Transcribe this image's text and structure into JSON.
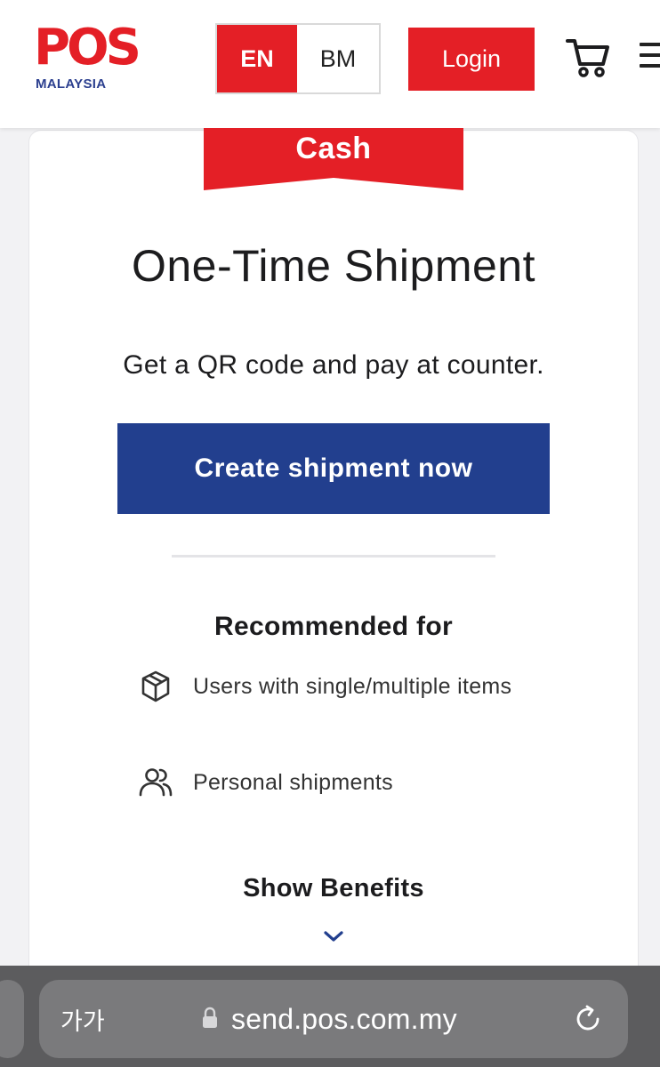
{
  "header": {
    "logo_text": "POS",
    "logo_subtext": "MALAYSIA",
    "lang_en": "EN",
    "lang_bm": "BM",
    "login_label": "Login",
    "cart_icon": "cart-icon",
    "menu_icon": "hamburger-menu-icon"
  },
  "card": {
    "ribbon_label": "Cash",
    "title": "One-Time Shipment",
    "subtitle": "Get a QR code and pay at counter.",
    "cta_label": "Create shipment now",
    "recommended_title": "Recommended for",
    "recommended_items": [
      {
        "icon": "package-icon",
        "text": "Users with single/multiple items"
      },
      {
        "icon": "users-icon",
        "text": "Personal shipments"
      }
    ],
    "benefits_label": "Show Benefits",
    "benefits_icon": "chevron-down-icon"
  },
  "browser": {
    "text_size_label": "가가",
    "url": "send.pos.com.my",
    "lock_icon": "lock-icon",
    "reload_icon": "reload-icon"
  },
  "colors": {
    "brand_red": "#e41f26",
    "brand_blue": "#223f8e",
    "logo_blue": "#2b3f8f"
  }
}
